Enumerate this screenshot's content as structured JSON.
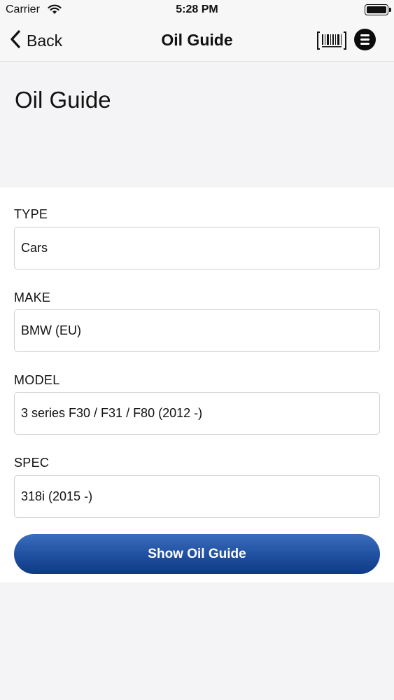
{
  "status_bar": {
    "carrier": "Carrier",
    "time": "5:28 PM",
    "icons": [
      "wifi-icon",
      "battery-icon"
    ]
  },
  "nav": {
    "back_label": "Back",
    "title": "Oil Guide",
    "icons": [
      "chevron-left-icon",
      "barcode-icon",
      "menu-icon"
    ]
  },
  "page": {
    "title": "Oil Guide"
  },
  "form": {
    "type": {
      "label": "TYPE",
      "value": "Cars"
    },
    "make": {
      "label": "MAKE",
      "value": "BMW (EU)"
    },
    "model": {
      "label": "MODEL",
      "value": "3 series F30 / F31 / F80 (2012 -)"
    },
    "spec": {
      "label": "SPEC",
      "value": "318i (2015 -)"
    },
    "submit_label": "Show Oil Guide"
  },
  "colors": {
    "accent": "#1f4f9f",
    "background": "#f4f4f6",
    "card": "#ffffff"
  }
}
